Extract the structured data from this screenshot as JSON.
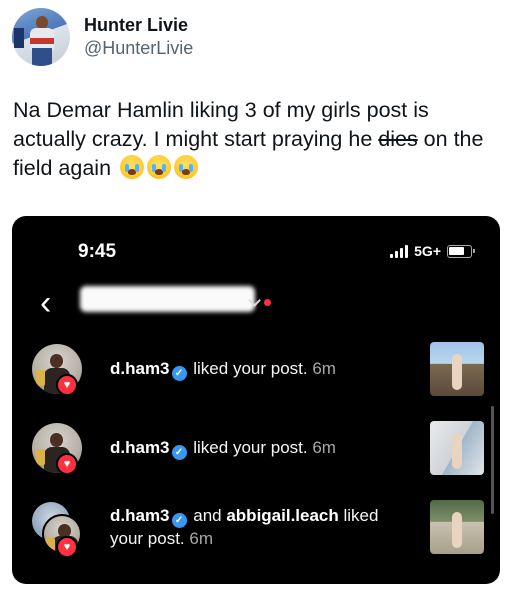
{
  "tweet": {
    "display_name": "Hunter Livie",
    "handle": "@HunterLivie",
    "text_before_strike": "Na Demar Hamlin liking 3 of my girls post is actually crazy. I might start praying he ",
    "text_strike": "dies",
    "text_after_strike": " on the field again",
    "emoji": [
      "loudly-crying-face",
      "loudly-crying-face",
      "loudly-crying-face"
    ]
  },
  "phone": {
    "status_bar": {
      "time": "9:45",
      "network": "5G+",
      "icons": [
        "signal-bars-icon",
        "battery-icon"
      ]
    },
    "header": {
      "back_icon": "chevron-left-icon",
      "username_redacted": true,
      "unread_dot_color": "#ff3040"
    },
    "notifications": [
      {
        "user": "d.ham3",
        "verified": true,
        "action": " liked your post.",
        "time": "6m",
        "other_user": ""
      },
      {
        "user": "d.ham3",
        "verified": true,
        "action": " liked your post.",
        "time": "6m",
        "other_user": ""
      },
      {
        "user": "d.ham3",
        "verified": true,
        "connector": " and ",
        "other_user": "abbigail.leach",
        "action": " liked your post.",
        "time": "6m"
      }
    ],
    "accent_colors": {
      "like_red": "#ff3040",
      "verified_blue": "#3897f0",
      "background": "#000000"
    }
  }
}
